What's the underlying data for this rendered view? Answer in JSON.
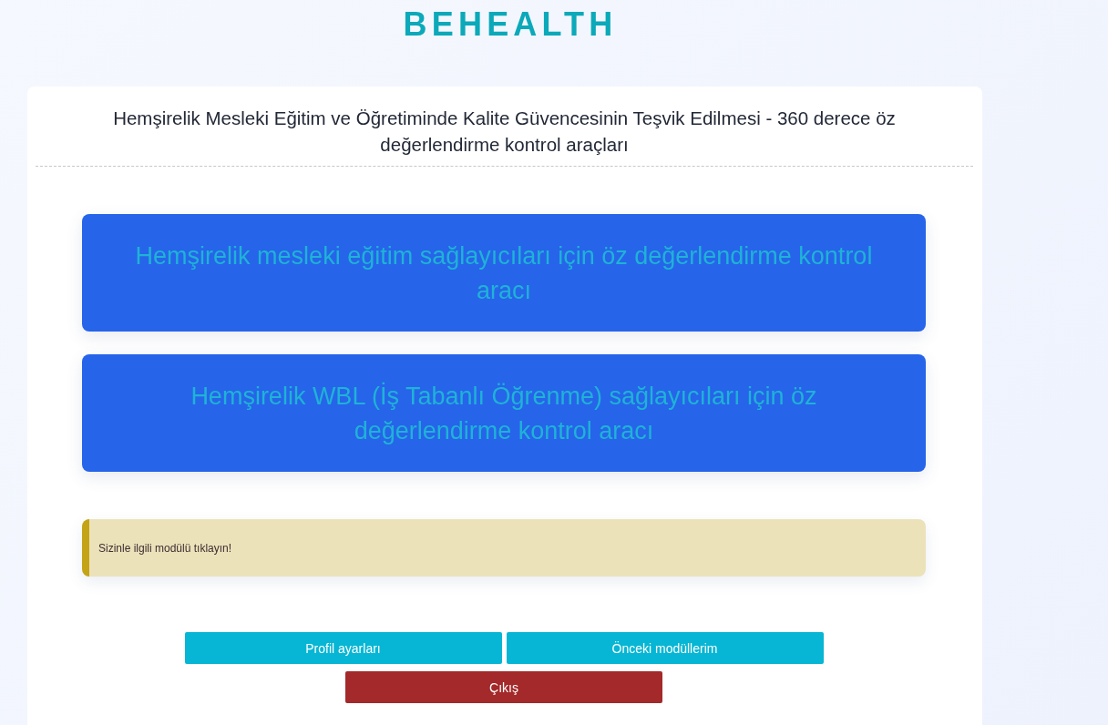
{
  "logo": "BEHEALTH",
  "page_title": "Hemşirelik Mesleki Eğitim ve Öğretiminde Kalite Güvencesinin Teşvik Edilmesi - 360 derece öz değerlendirme kontrol araçları",
  "modules": [
    {
      "label": "Hemşirelik mesleki eğitim sağlayıcıları için öz değerlendirme kontrol aracı"
    },
    {
      "label": "Hemşirelik WBL (İş Tabanlı Öğrenme) sağlayıcıları için öz değerlendirme kontrol aracı"
    }
  ],
  "alert": {
    "kind": "warning",
    "text": "Sizinle ilgili modülü tıklayın!"
  },
  "actions": [
    {
      "label": "Profil ayarları",
      "kind": "primary"
    },
    {
      "label": "Önceki modüllerim",
      "kind": "primary"
    },
    {
      "label": "Çıkış",
      "kind": "danger"
    }
  ]
}
